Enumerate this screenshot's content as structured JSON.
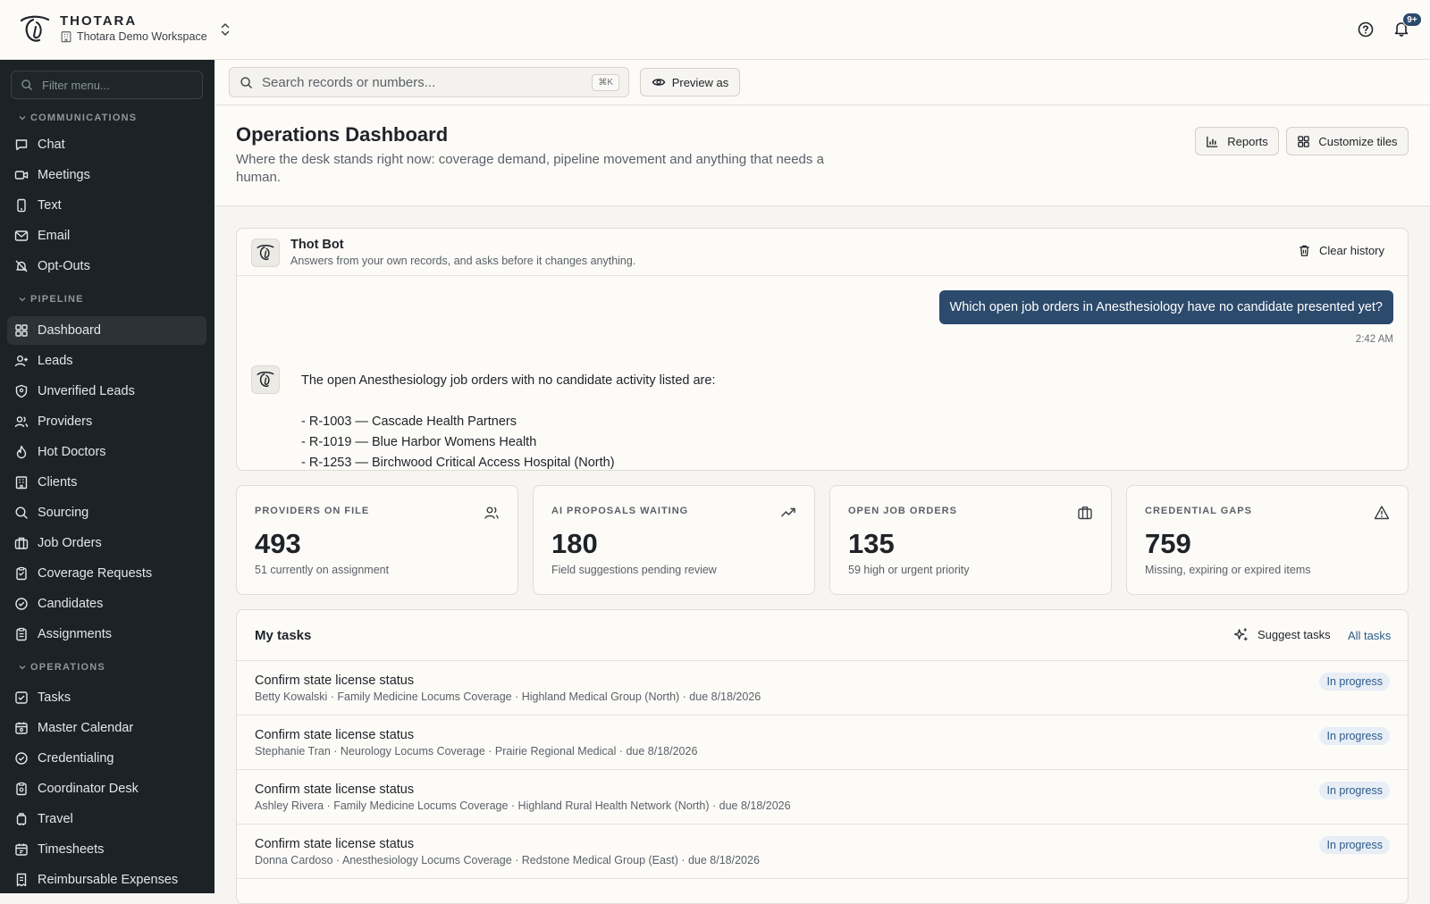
{
  "app": {
    "brand": "THOTARA",
    "workspace": "Thotara Demo Workspace",
    "notification_badge": "9+"
  },
  "sidebar": {
    "filter_placeholder": "Filter menu...",
    "sections": [
      {
        "label": "COMMUNICATIONS",
        "items": [
          {
            "label": "Chat",
            "icon": "chat-icon"
          },
          {
            "label": "Meetings",
            "icon": "video-icon"
          },
          {
            "label": "Text",
            "icon": "phone-icon"
          },
          {
            "label": "Email",
            "icon": "mail-icon"
          },
          {
            "label": "Opt-Outs",
            "icon": "bell-off-icon"
          }
        ]
      },
      {
        "label": "PIPELINE",
        "items": [
          {
            "label": "Dashboard",
            "icon": "grid-icon",
            "active": true
          },
          {
            "label": "Leads",
            "icon": "user-plus-icon"
          },
          {
            "label": "Unverified Leads",
            "icon": "shield-icon"
          },
          {
            "label": "Providers",
            "icon": "users-icon"
          },
          {
            "label": "Hot Doctors",
            "icon": "flame-icon"
          },
          {
            "label": "Clients",
            "icon": "building-icon"
          },
          {
            "label": "Sourcing",
            "icon": "search-icon"
          },
          {
            "label": "Job Orders",
            "icon": "briefcase-icon"
          },
          {
            "label": "Coverage Requests",
            "icon": "clipboard-icon"
          },
          {
            "label": "Candidates",
            "icon": "check-circle-icon"
          },
          {
            "label": "Assignments",
            "icon": "clipboard-list-icon"
          }
        ]
      },
      {
        "label": "OPERATIONS",
        "items": [
          {
            "label": "Tasks",
            "icon": "check-square-icon"
          },
          {
            "label": "Master Calendar",
            "icon": "calendar-icon"
          },
          {
            "label": "Credentialing",
            "icon": "check-circle-icon"
          },
          {
            "label": "Coordinator Desk",
            "icon": "desk-icon"
          },
          {
            "label": "Travel",
            "icon": "luggage-icon"
          },
          {
            "label": "Timesheets",
            "icon": "calendar-clock-icon"
          },
          {
            "label": "Reimbursable Expenses",
            "icon": "receipt-icon"
          }
        ]
      }
    ]
  },
  "toolbar": {
    "search_placeholder": "Search records or numbers...",
    "search_shortcut": "⌘K",
    "preview_label": "Preview as"
  },
  "page": {
    "title": "Operations Dashboard",
    "subtitle": "Where the desk stands right now: coverage demand, pipeline movement and anything that needs a human.",
    "reports_label": "Reports",
    "customize_label": "Customize tiles"
  },
  "bot": {
    "name": "Thot Bot",
    "description": "Answers from your own records, and asks before it changes anything.",
    "clear_label": "Clear history",
    "user_message": "Which open job orders in Anesthesiology have no candidate presented yet?",
    "message_time": "2:42 AM",
    "reply_intro": "The open Anesthesiology job orders with no candidate activity listed are:",
    "reply_items": [
      "- R-1003 — Cascade Health Partners",
      "- R-1019 — Blue Harbor Womens Health",
      "- R-1253 — Birchwood Critical Access Hospital (North)"
    ]
  },
  "stats": [
    {
      "label": "PROVIDERS ON FILE",
      "value": "493",
      "sub": "51 currently on assignment",
      "icon": "users-icon"
    },
    {
      "label": "AI PROPOSALS WAITING",
      "value": "180",
      "sub": "Field suggestions pending review",
      "icon": "trending-up-icon"
    },
    {
      "label": "OPEN JOB ORDERS",
      "value": "135",
      "sub": "59 high or urgent priority",
      "icon": "briefcase-icon"
    },
    {
      "label": "CREDENTIAL GAPS",
      "value": "759",
      "sub": "Missing, expiring or expired items",
      "icon": "alert-triangle-icon"
    }
  ],
  "tasks": {
    "title": "My tasks",
    "suggest_label": "Suggest tasks",
    "all_label": "All tasks",
    "rows": [
      {
        "title": "Confirm state license status",
        "meta": "Betty Kowalski · Family Medicine Locums Coverage · Highland Medical Group (North) · due 8/18/2026",
        "status": "In progress"
      },
      {
        "title": "Confirm state license status",
        "meta": "Stephanie Tran · Neurology Locums Coverage · Prairie Regional Medical · due 8/18/2026",
        "status": "In progress"
      },
      {
        "title": "Confirm state license status",
        "meta": "Ashley Rivera · Family Medicine Locums Coverage · Highland Rural Health Network (North) · due 8/18/2026",
        "status": "In progress"
      },
      {
        "title": "Confirm state license status",
        "meta": "Donna Cardoso · Anesthesiology Locums Coverage · Redstone Medical Group (East) · due 8/18/2026",
        "status": "In progress"
      }
    ]
  }
}
